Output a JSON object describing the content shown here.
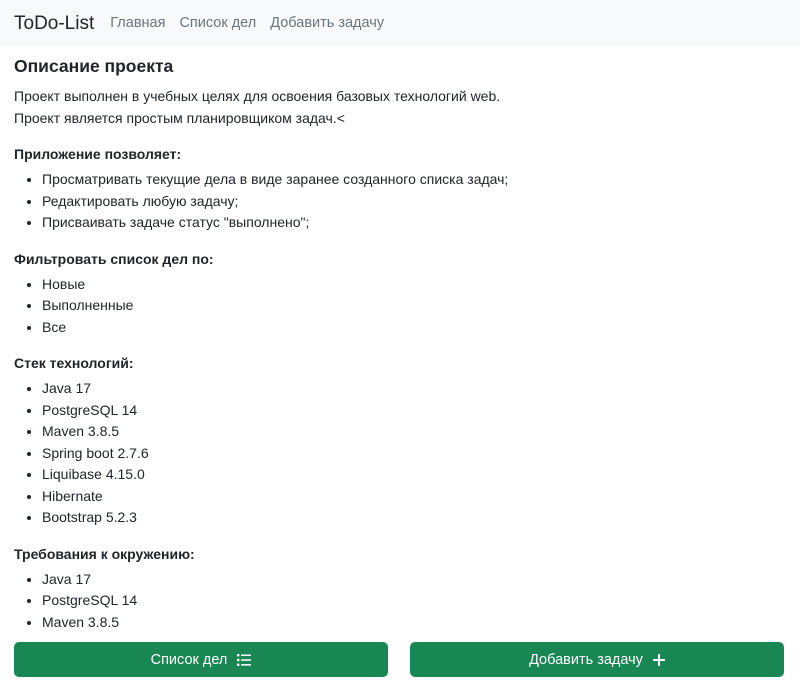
{
  "navbar": {
    "brand": "ToDo-List",
    "links": [
      "Главная",
      "Список дел",
      "Добавить задачу"
    ]
  },
  "main": {
    "title": "Описание проекта",
    "intro": [
      "Проект выполнен в учебных целях для освоения базовых технологий web.",
      "Проект является простым планировщиком задач.<"
    ],
    "sections": [
      {
        "heading": "Приложение позволяет:",
        "items": [
          "Просматривать текущие дела в виде заранее созданного списка задач;",
          "Редактировать любую задачу;",
          "Присваивать задаче статус \"выполнено\";"
        ]
      },
      {
        "heading": "Фильтровать список дел по:",
        "items": [
          "Новые",
          "Выполненные",
          "Все"
        ]
      },
      {
        "heading": "Стек технологий:",
        "items": [
          "Java 17",
          "PostgreSQL 14",
          "Maven 3.8.5",
          "Spring boot 2.7.6",
          "Liquibase 4.15.0",
          "Hibernate",
          "Bootstrap 5.2.3"
        ]
      },
      {
        "heading": "Требования к окружению:",
        "items": [
          "Java 17",
          "PostgreSQL 14",
          "Maven 3.8.5"
        ]
      }
    ]
  },
  "buttons": {
    "list_label": "Список дел",
    "list_icon": "list-icon",
    "add_label": "Добавить задачу",
    "add_icon": "plus-icon",
    "color": "#198754"
  }
}
